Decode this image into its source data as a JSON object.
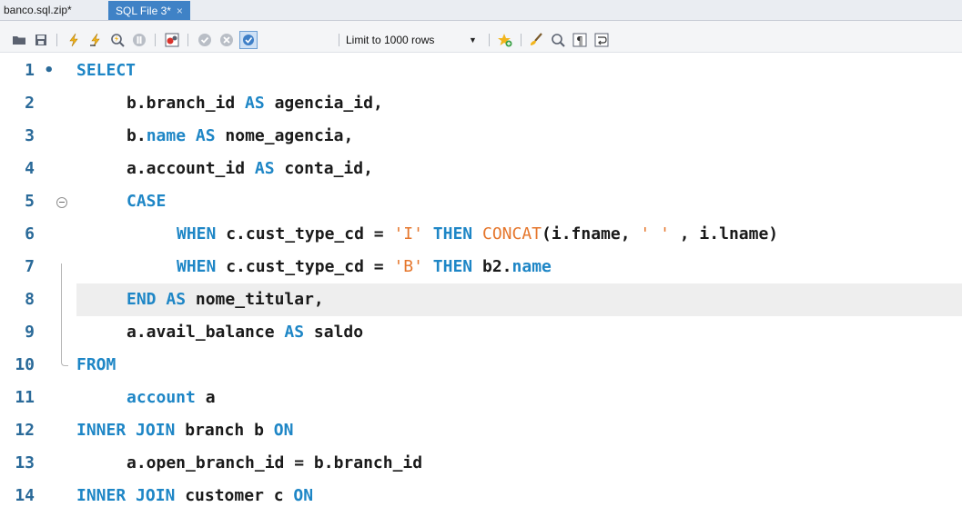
{
  "tabs": [
    {
      "label": "banco.sql.zip*",
      "active": false
    },
    {
      "label": "SQL File 3*",
      "active": true,
      "close": "×"
    }
  ],
  "toolbar": {
    "limit_select": "Limit to 1000 rows",
    "icons": [
      "open-folder-icon",
      "save-icon",
      "execute-icon",
      "execute-current-icon",
      "explain-icon",
      "stop-icon",
      "toggle-error-icon",
      "commit-icon",
      "rollback-icon",
      "autocommit-icon",
      "limit-dropdown",
      "add-snippet-icon",
      "beautify-icon",
      "find-icon",
      "invisible-chars-icon",
      "wrap-icon"
    ]
  },
  "colors": {
    "keyword": "#1e86c6",
    "string": "#e5762c",
    "line_number": "#2a6a99",
    "tab_active": "#3f82c6"
  },
  "editor": {
    "current_line": 8,
    "lines": [
      {
        "n": "1",
        "bullet": "•",
        "indent": 0,
        "tokens": [
          {
            "t": "SELECT",
            "c": "kw"
          }
        ]
      },
      {
        "n": "2",
        "indent": 1,
        "tokens": [
          {
            "t": "b.branch_id ",
            "c": "id"
          },
          {
            "t": "AS",
            "c": "kw"
          },
          {
            "t": " agencia_id,",
            "c": "id"
          }
        ]
      },
      {
        "n": "3",
        "indent": 1,
        "tokens": [
          {
            "t": "b.",
            "c": "id"
          },
          {
            "t": "name",
            "c": "kw"
          },
          {
            "t": " ",
            "c": "id"
          },
          {
            "t": "AS",
            "c": "kw"
          },
          {
            "t": " nome_agencia,",
            "c": "id"
          }
        ]
      },
      {
        "n": "4",
        "indent": 1,
        "tokens": [
          {
            "t": "a.account_id ",
            "c": "id"
          },
          {
            "t": "AS",
            "c": "kw"
          },
          {
            "t": " conta_id,",
            "c": "id"
          }
        ]
      },
      {
        "n": "5",
        "indent": 1,
        "fold": true,
        "tokens": [
          {
            "t": "CASE",
            "c": "kw"
          }
        ]
      },
      {
        "n": "6",
        "indent": 2,
        "tokens": [
          {
            "t": "WHEN",
            "c": "kw"
          },
          {
            "t": " c.cust_type_cd = ",
            "c": "id"
          },
          {
            "t": "'I'",
            "c": "str"
          },
          {
            "t": " ",
            "c": "id"
          },
          {
            "t": "THEN",
            "c": "kw"
          },
          {
            "t": " ",
            "c": "id"
          },
          {
            "t": "CONCAT",
            "c": "fn"
          },
          {
            "t": "(i.fname, ",
            "c": "id"
          },
          {
            "t": "' '",
            "c": "str"
          },
          {
            "t": " , i.lname)",
            "c": "id"
          }
        ]
      },
      {
        "n": "7",
        "indent": 2,
        "tokens": [
          {
            "t": "WHEN",
            "c": "kw"
          },
          {
            "t": " c.cust_type_cd = ",
            "c": "id"
          },
          {
            "t": "'B'",
            "c": "str"
          },
          {
            "t": " ",
            "c": "id"
          },
          {
            "t": "THEN",
            "c": "kw"
          },
          {
            "t": " b2.",
            "c": "id"
          },
          {
            "t": "name",
            "c": "kw"
          }
        ]
      },
      {
        "n": "8",
        "indent": 1,
        "tokens": [
          {
            "t": "END",
            "c": "kw"
          },
          {
            "t": " ",
            "c": "id"
          },
          {
            "t": "AS",
            "c": "kw"
          },
          {
            "t": " nome_titular,",
            "c": "id"
          }
        ]
      },
      {
        "n": "9",
        "indent": 1,
        "tokens": [
          {
            "t": "a.avail_balance ",
            "c": "id"
          },
          {
            "t": "AS",
            "c": "kw"
          },
          {
            "t": " saldo",
            "c": "id"
          }
        ]
      },
      {
        "n": "10",
        "indent": 0,
        "tokens": [
          {
            "t": "FROM",
            "c": "kw"
          }
        ]
      },
      {
        "n": "11",
        "indent": 1,
        "tokens": [
          {
            "t": "account",
            "c": "kw"
          },
          {
            "t": " a",
            "c": "id"
          }
        ]
      },
      {
        "n": "12",
        "indent": 0,
        "tokens": [
          {
            "t": "INNER JOIN",
            "c": "kw"
          },
          {
            "t": " branch b ",
            "c": "id"
          },
          {
            "t": "ON",
            "c": "kw"
          }
        ]
      },
      {
        "n": "13",
        "indent": 1,
        "tokens": [
          {
            "t": "a.open_branch_id = b.branch_id",
            "c": "id"
          }
        ]
      },
      {
        "n": "14",
        "indent": 0,
        "tokens": [
          {
            "t": "INNER JOIN",
            "c": "kw"
          },
          {
            "t": " customer c ",
            "c": "id"
          },
          {
            "t": "ON",
            "c": "kw"
          }
        ]
      }
    ]
  }
}
